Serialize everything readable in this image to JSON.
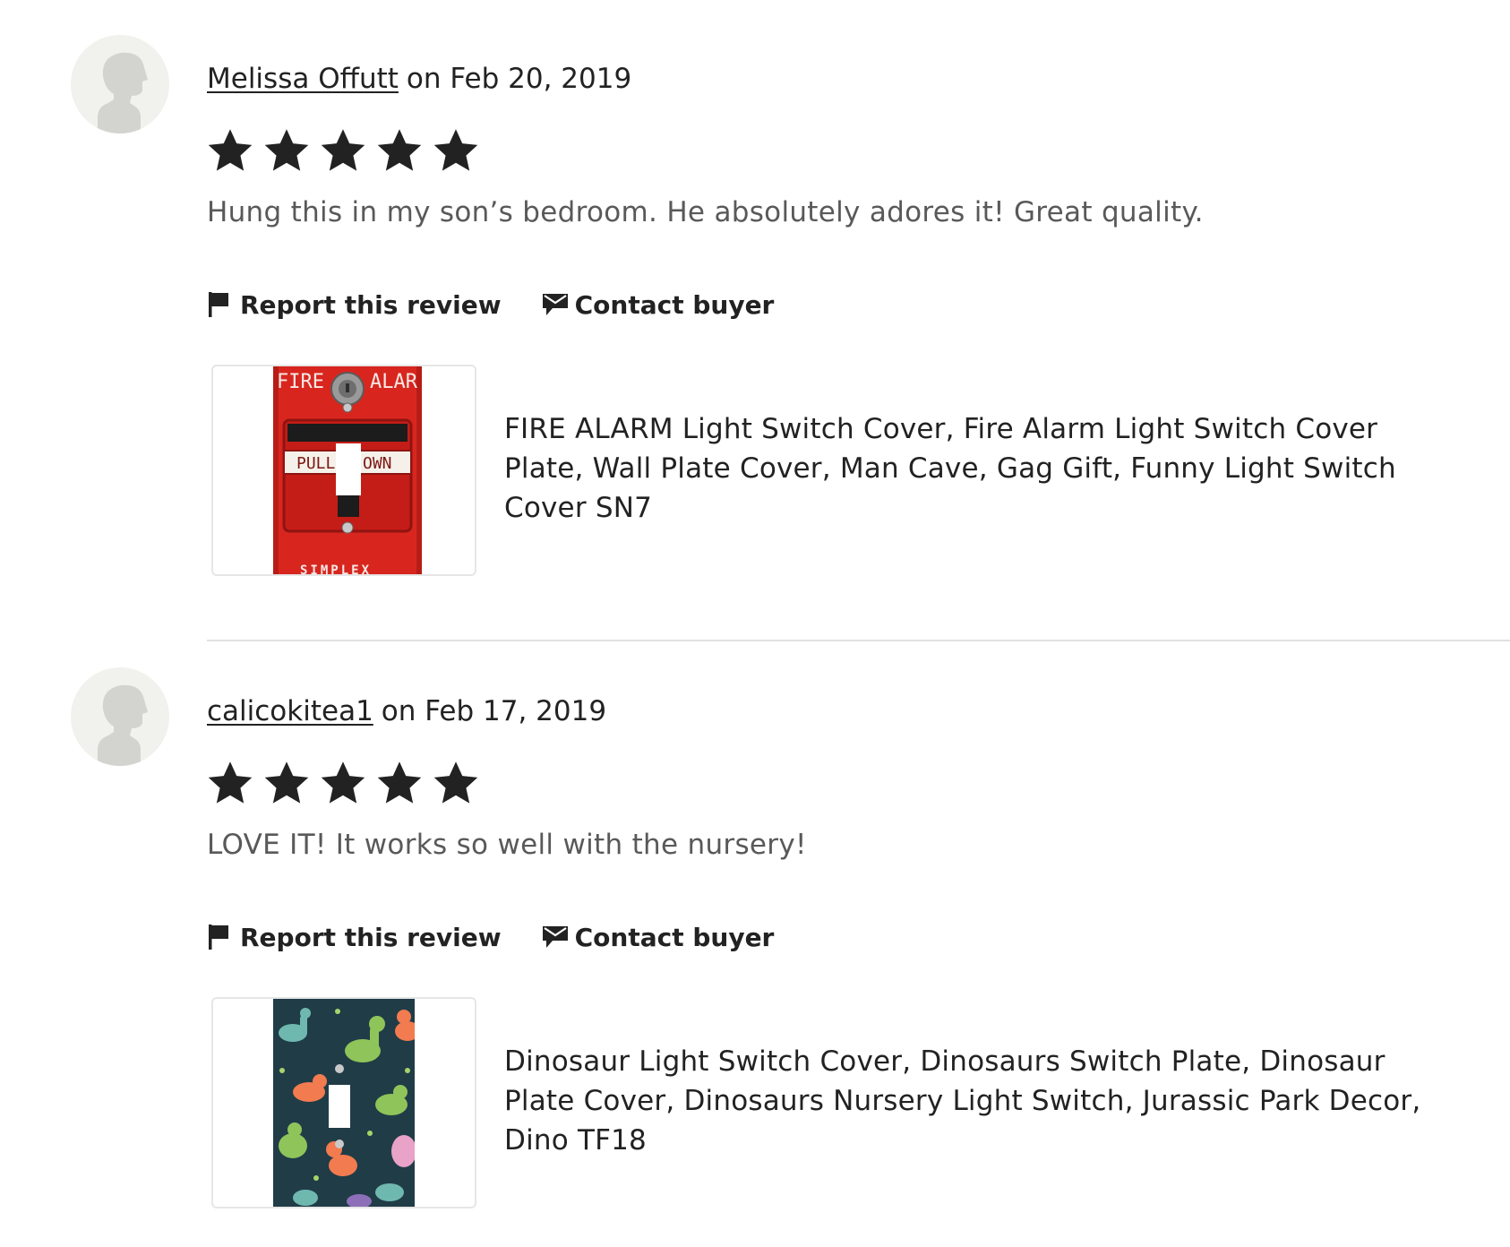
{
  "reviews": [
    {
      "author": "Melissa Offutt",
      "date_prefix": "on",
      "date": "Feb 20, 2019",
      "rating": 5,
      "text": "Hung this in my son’s bedroom. He absolutely adores it! Great quality.",
      "report_label": "Report this review",
      "contact_label": "Contact buyer",
      "listing_title": "FIRE ALARM Light Switch Cover, Fire Alarm Light Switch Cover Plate, Wall Plate Cover, Man Cave, Gag Gift, Funny Light Switch Cover SN7",
      "thumb_labels": {
        "top_left": "FIRE",
        "top_right": "ALAR",
        "pull_left": "PULL",
        "pull_right": "OWN",
        "brand": "SIMPLEX"
      }
    },
    {
      "author": "calicokitea1",
      "date_prefix": "on",
      "date": "Feb 17, 2019",
      "rating": 5,
      "text": "LOVE IT! It works so well with the nursery!",
      "report_label": "Report this review",
      "contact_label": "Contact buyer",
      "listing_title": "Dinosaur Light Switch Cover, Dinosaurs Switch Plate, Dinosaur Plate Cover, Dinosaurs Nursery Light Switch, Jurassic Park Decor, Dino TF18"
    }
  ],
  "colors": {
    "text": "#222222",
    "muted_text": "#595959",
    "star": "#222222",
    "avatar_bg": "#f1f1ee",
    "avatar_fg": "#d3d3d0",
    "divider": "#e1e1e1",
    "fire_red": "#d8261f",
    "dino_bg": "#203c47"
  },
  "icons": {
    "avatar": "person-silhouette-icon",
    "star": "star-filled-icon",
    "report": "flag-icon",
    "contact": "envelope-icon"
  }
}
